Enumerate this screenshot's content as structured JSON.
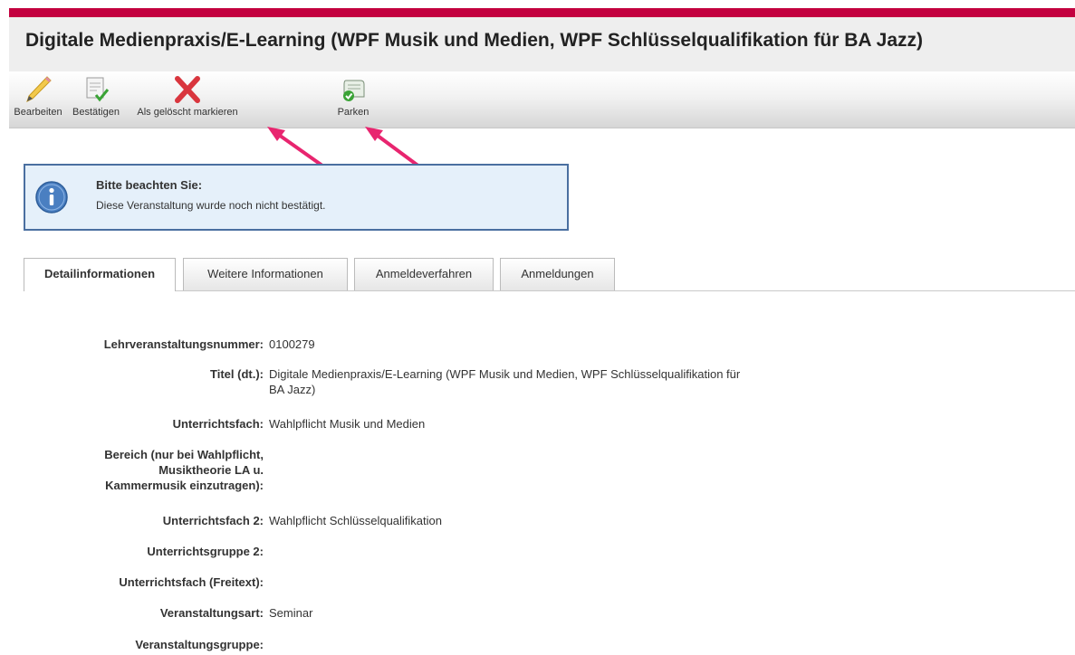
{
  "page_title": "Digitale Medienpraxis/E-Learning (WPF Musik und Medien, WPF Schlüsselqualifikation für BA Jazz)",
  "toolbar": {
    "edit_label": "Bearbeiten",
    "confirm_label": "Bestätigen",
    "delete_label": "Als gelöscht markieren",
    "park_label": "Parken"
  },
  "notice": {
    "title": "Bitte beachten Sie:",
    "text": "Diese Veranstaltung wurde noch nicht bestätigt."
  },
  "tabs": [
    {
      "label": "Detailinformationen"
    },
    {
      "label": "Weitere Informationen"
    },
    {
      "label": "Anmeldeverfahren"
    },
    {
      "label": "Anmeldungen"
    }
  ],
  "fields": [
    {
      "label": "Lehrveranstaltungsnummer:",
      "value": "0100279"
    },
    {
      "label": "Titel (dt.):",
      "value_line1": "Digitale Medienpraxis/E-Learning (WPF Musik und Medien, WPF Schlüsselqualifikation für",
      "value_line2": "BA Jazz)"
    },
    {
      "label": "Unterrichtsfach:",
      "value": "Wahlpflicht Musik und Medien"
    },
    {
      "label_line1": "Bereich (nur bei Wahlpflicht,",
      "label_line2": "Musiktheorie LA u.",
      "label_line3": "Kammermusik einzutragen):",
      "value": ""
    },
    {
      "label": "Unterrichtsfach 2:",
      "value": "Wahlpflicht Schlüsselqualifikation"
    },
    {
      "label": "Unterrichtsgruppe 2:",
      "value": ""
    },
    {
      "label": "Unterrichtsfach (Freitext):",
      "value": ""
    },
    {
      "label": "Veranstaltungsart:",
      "value": "Seminar"
    },
    {
      "label": "Veranstaltungsgruppe:",
      "value": ""
    }
  ],
  "colors": {
    "brand_strip": "#c3003f",
    "annotation_arrow": "#e8256f",
    "notice_background": "#e5f0fa",
    "notice_border": "#4a6fa0"
  }
}
